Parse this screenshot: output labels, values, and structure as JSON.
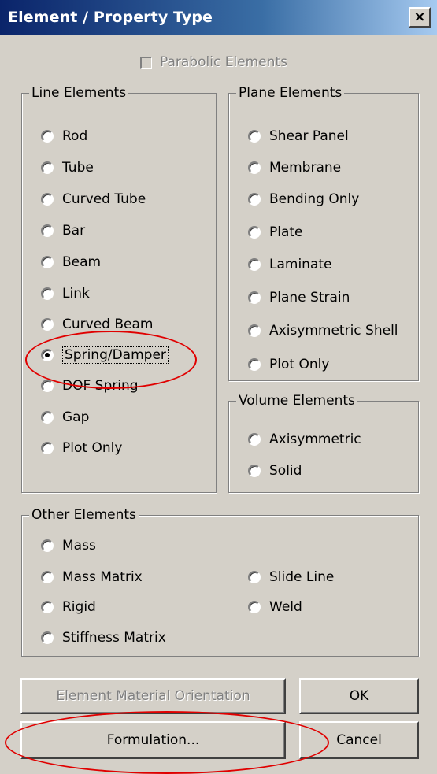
{
  "window": {
    "title": "Element / Property Type",
    "close_label": "×"
  },
  "parabolic": {
    "label": "Parabolic Elements",
    "checked": false,
    "enabled": false
  },
  "line_elements": {
    "label": "Line Elements",
    "items": [
      "Rod",
      "Tube",
      "Curved Tube",
      "Bar",
      "Beam",
      "Link",
      "Curved Beam",
      "Spring/Damper",
      "DOF Spring",
      "Gap",
      "Plot Only"
    ],
    "selected": "Spring/Damper"
  },
  "plane_elements": {
    "label": "Plane Elements",
    "items": [
      "Shear Panel",
      "Membrane",
      "Bending Only",
      "Plate",
      "Laminate",
      "Plane Strain",
      "Axisymmetric Shell",
      "Plot Only"
    ]
  },
  "volume_elements": {
    "label": "Volume Elements",
    "items": [
      "Axisymmetric",
      "Solid"
    ]
  },
  "other_elements": {
    "label": "Other Elements",
    "left_items": [
      "Mass",
      "Mass Matrix",
      "Rigid",
      "Stiffness Matrix"
    ],
    "right_items": [
      "Slide Line",
      "Weld"
    ]
  },
  "buttons": {
    "orientation": "Element Material Orientation",
    "formulation": "Formulation...",
    "ok": "OK",
    "cancel": "Cancel"
  },
  "colors": {
    "title_bar": "#0a246a",
    "dialog_bg": "#d4d0c8",
    "annotation": "#e00000"
  }
}
